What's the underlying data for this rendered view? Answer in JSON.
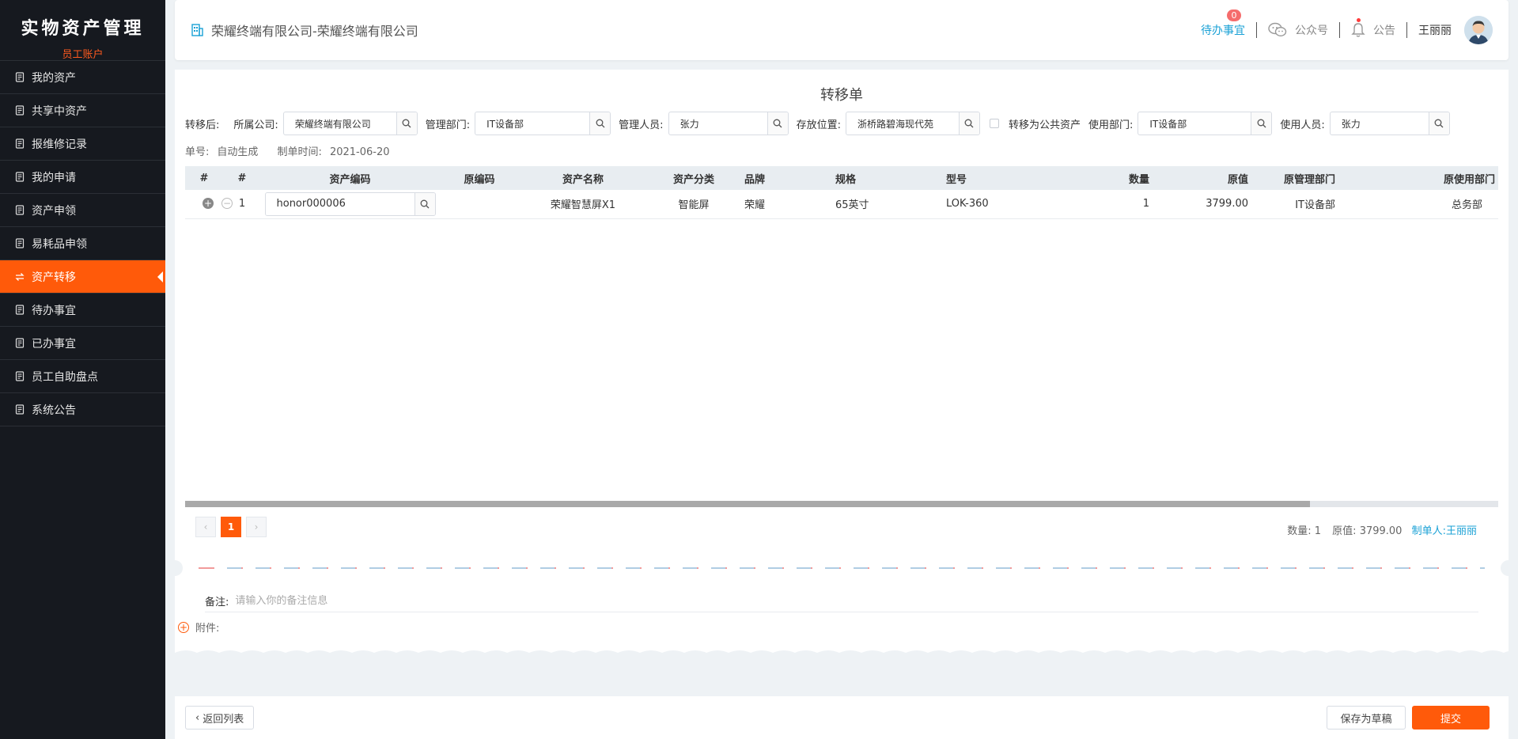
{
  "brand": {
    "title": "实物资产管理",
    "subtitle": "员工账户"
  },
  "sidebar": {
    "items": [
      {
        "label": "我的资产",
        "icon": "asset-doc-icon"
      },
      {
        "label": "共享中资产",
        "icon": "share-doc-icon"
      },
      {
        "label": "报维修记录",
        "icon": "repair-doc-icon"
      },
      {
        "label": "我的申请",
        "icon": "apply-doc-icon"
      },
      {
        "label": "资产申领",
        "icon": "claim-doc-icon"
      },
      {
        "label": "易耗品申领",
        "icon": "consumable-doc-icon"
      },
      {
        "label": "资产转移",
        "icon": "transfer-icon",
        "active": true
      },
      {
        "label": "待办事宜",
        "icon": "todo-doc-icon"
      },
      {
        "label": "已办事宜",
        "icon": "done-doc-icon"
      },
      {
        "label": "员工自助盘点",
        "icon": "inventory-icon"
      },
      {
        "label": "系统公告",
        "icon": "notice-list-icon"
      }
    ]
  },
  "header": {
    "company": "荣耀终端有限公司-荣耀终端有限公司",
    "todo_label": "待办事宜",
    "todo_count": "0",
    "wechat_label": "公众号",
    "notice_label": "公告",
    "user_name": "王丽丽"
  },
  "form": {
    "title": "转移单",
    "after_label": "转移后:",
    "company_label": "所属公司:",
    "company_value": "荣耀终端有限公司",
    "manage_dept_label": "管理部门:",
    "manage_dept_value": "IT设备部",
    "manager_label": "管理人员:",
    "manager_value": "张力",
    "location_label": "存放位置:",
    "location_value": "浙桥路碧海现代苑",
    "public_label": "转移为公共资产",
    "use_dept_label": "使用部门:",
    "use_dept_value": "IT设备部",
    "user_label": "使用人员:",
    "user_value": "张力",
    "order_label": "单号:",
    "order_value": "自动生成",
    "time_label": "制单时间:",
    "time_value": "2021-06-20"
  },
  "table": {
    "columns": [
      "#",
      "#",
      "资产编码",
      "原编码",
      "资产名称",
      "资产分类",
      "品牌",
      "规格",
      "型号",
      "数量",
      "原值",
      "原管理部门",
      "原使用部门"
    ],
    "rows": [
      {
        "index": "1",
        "code": "honor000006",
        "orig_code": "",
        "name": "荣耀智慧屏X1",
        "category": "智能屏",
        "brand": "荣耀",
        "spec": "65英寸",
        "model": "LOK-360",
        "qty": "1",
        "value": "3799.00",
        "orig_manage_dept": "IT设备部",
        "orig_use_dept": "总务部"
      }
    ]
  },
  "pager": {
    "prev": "‹",
    "current": "1",
    "next": "›"
  },
  "summary": {
    "qty_label": "数量:",
    "qty": "1",
    "value_label": "原值:",
    "value": "3799.00",
    "maker_label": "制单人:",
    "maker": "王丽丽"
  },
  "remark": {
    "label": "备注:",
    "placeholder": "请输入你的备注信息"
  },
  "attachment": {
    "label": "附件:"
  },
  "footer": {
    "back_label": "返回列表",
    "draft_label": "保存为草稿",
    "submit_label": "提交"
  },
  "colors": {
    "accent": "#ff5a0a",
    "link": "#1aa1d6",
    "sidebar_bg": "#16191f",
    "badge": "#f56c6c"
  }
}
